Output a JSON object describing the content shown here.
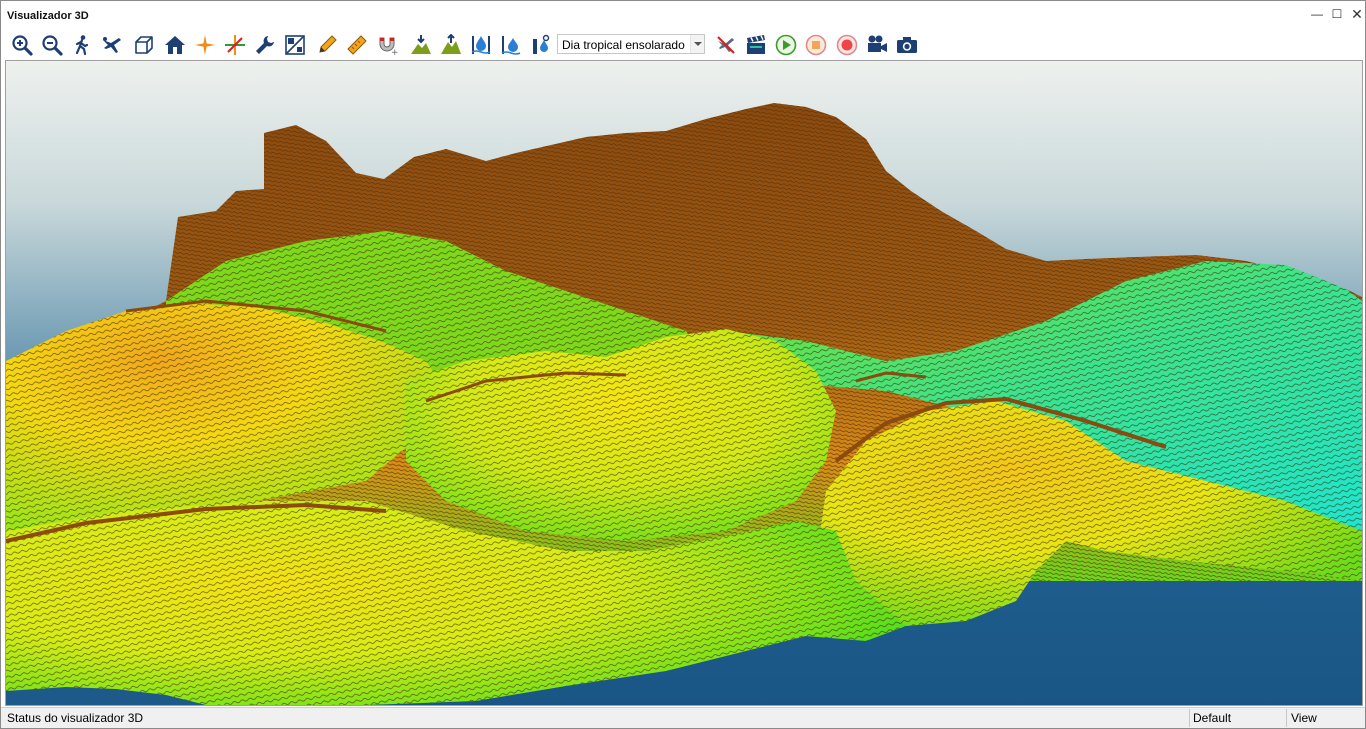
{
  "window": {
    "title": "Visualizador 3D",
    "controls": {
      "minimize": "—",
      "maximize": "☐",
      "close": "✕"
    }
  },
  "toolbar": {
    "buttons": [
      {
        "icon": "zoom-in-icon"
      },
      {
        "icon": "zoom-out-icon"
      },
      {
        "icon": "walk-icon"
      },
      {
        "icon": "fly-icon"
      },
      {
        "icon": "cube-icon"
      },
      {
        "icon": "home-icon"
      },
      {
        "icon": "center-star-icon"
      },
      {
        "icon": "axes-icon"
      },
      {
        "icon": "wrench-icon"
      },
      {
        "icon": "scale-ratio-icon"
      },
      {
        "icon": "pencil-icon"
      },
      {
        "icon": "ruler-icon"
      },
      {
        "icon": "magnet-icon"
      },
      {
        "icon": "lower-terrain-icon"
      },
      {
        "icon": "raise-terrain-icon"
      },
      {
        "icon": "water-level-icon"
      },
      {
        "icon": "water-raise-icon"
      },
      {
        "icon": "water-settings-icon"
      }
    ],
    "scene_select": {
      "value": "Dia tropical ensolarado"
    },
    "media_buttons": [
      {
        "icon": "clear-path-icon"
      },
      {
        "icon": "clapperboard-icon"
      },
      {
        "icon": "play-icon"
      },
      {
        "icon": "stop-icon"
      },
      {
        "icon": "record-icon"
      },
      {
        "icon": "video-camera-icon"
      },
      {
        "icon": "photo-camera-icon"
      }
    ]
  },
  "colors": {
    "sky_top": "#eef1ee",
    "sky_bottom": "#2c6892",
    "water": "#1d5a8a",
    "terrain_high": "#8a4a10",
    "terrain_mid": "#e6a21a",
    "terrain_low": "#f5e610",
    "terrain_green": "#7fe81a",
    "terrain_cyan": "#22e4c4"
  },
  "statusbar": {
    "message": "Status do visualizador 3D",
    "mode": "Default",
    "panel": "View"
  }
}
